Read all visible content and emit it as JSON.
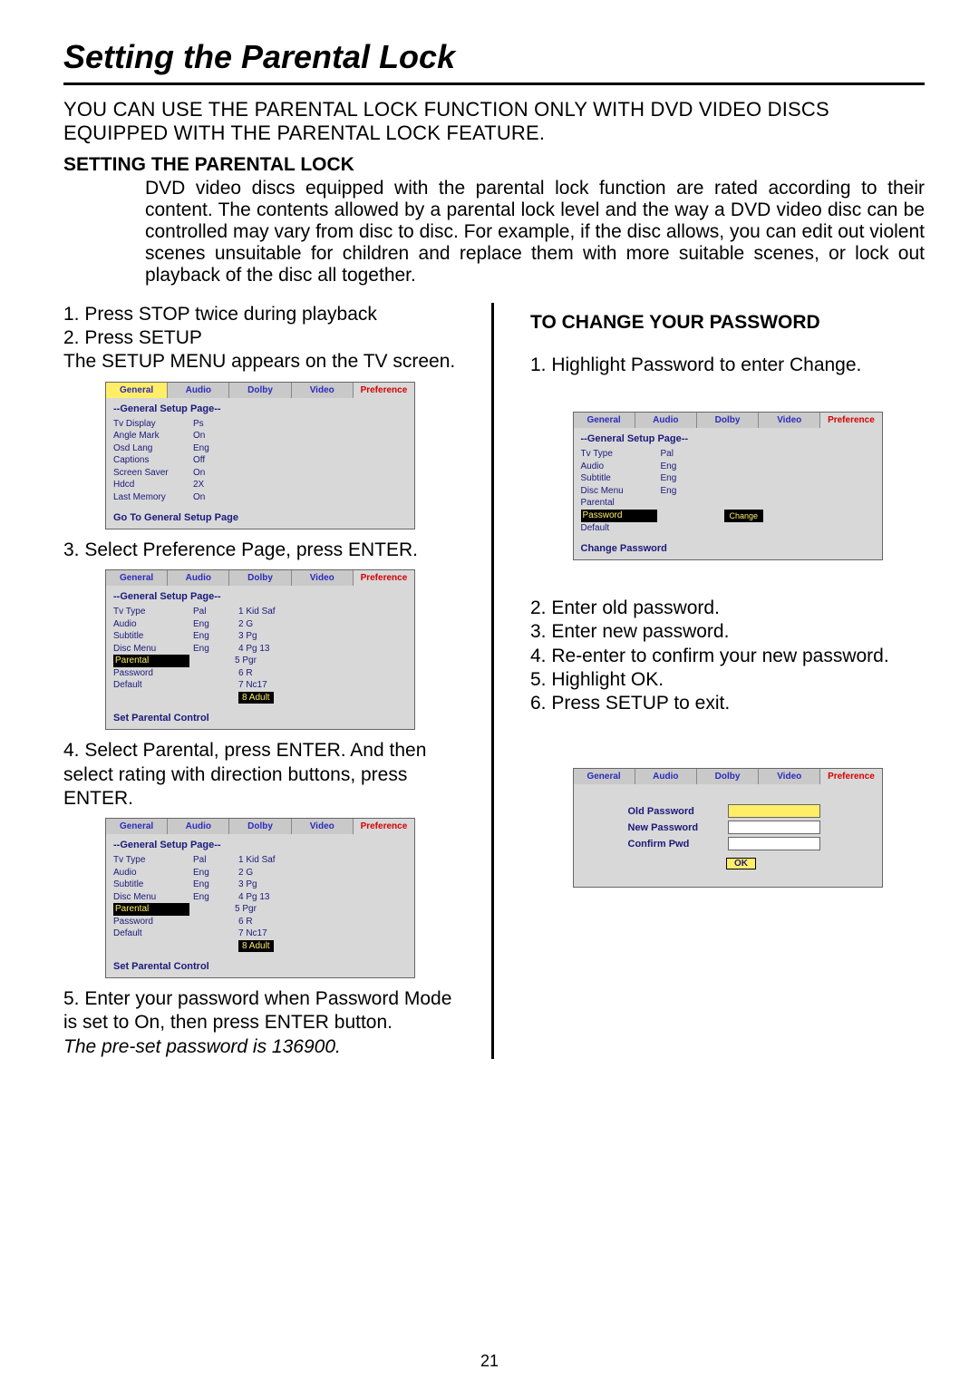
{
  "title": "Setting the Parental Lock",
  "intro": "YOU CAN USE THE PARENTAL LOCK FUNCTION ONLY WITH DVD VIDEO DISCS EQUIPPED WITH THE PARENTAL LOCK FEATURE.",
  "sec1_h": "SETTING THE PARENTAL LOCK",
  "sec1_p": "DVD video discs equipped with the parental lock function are rated according to their content.  The contents allowed by a parental lock level and the way a DVD video disc can be controlled may vary from disc to disc.  For example, if the disc allows, you can edit out violent scenes unsuitable for children and replace them with more suitable scenes, or lock out playback of the disc all together.",
  "left": {
    "s1": "1. Press STOP twice during playback",
    "s2": "2. Press SETUP",
    "s2b": "The SETUP MENU appears on the TV screen.",
    "s3": "3. Select Preference Page,  press ENTER.",
    "s4": "4. Select Parental, press ENTER. And then select rating with direction buttons, press ENTER.",
    "s5": "5. Enter your password when Password Mode is set to On, then press ENTER button.",
    "note": "The pre-set password is 136900."
  },
  "right": {
    "h": "TO CHANGE YOUR PASSWORD",
    "s1": "1. Highlight Password to enter Change.",
    "s2": "2. Enter old password.",
    "s3": "3. Enter new password.",
    "s4": "4. Re-enter to confirm your new password.",
    "s5": "5. Highlight OK.",
    "s6": "6. Press SETUP to exit."
  },
  "tabs": {
    "general": "General",
    "audio": "Audio",
    "dolby": "Dolby",
    "video": "Video",
    "pref": "Preference"
  },
  "pagehd": "--General Setup Page--",
  "f1": {
    "rows": [
      [
        "Tv Display",
        "Ps"
      ],
      [
        "Angle Mark",
        "On"
      ],
      [
        "Osd Lang",
        "Eng"
      ],
      [
        "Captions",
        "Off"
      ],
      [
        "Screen Saver",
        "On"
      ],
      [
        "Hdcd",
        "2X"
      ],
      [
        "Last Memory",
        "On"
      ]
    ],
    "foot": "Go To General Setup Page"
  },
  "ratings": [
    "1 Kid Saf",
    "2 G",
    "3 Pg",
    "4 Pg 13",
    "5 Pgr",
    "6 R",
    "7 Nc17",
    "8 Adult"
  ],
  "f2": {
    "rows": [
      [
        "Tv Type",
        "Pal"
      ],
      [
        "Audio",
        "Eng"
      ],
      [
        "Subtitle",
        "Eng"
      ],
      [
        "Disc Menu",
        "Eng"
      ],
      [
        "Parental",
        ""
      ],
      [
        "Password",
        ""
      ],
      [
        "Default",
        ""
      ]
    ],
    "foot": "Set Parental Control",
    "hl": 4
  },
  "f3": {
    "rows": [
      [
        "Tv Type",
        "Pal"
      ],
      [
        "Audio",
        "Eng"
      ],
      [
        "Subtitle",
        "Eng"
      ],
      [
        "Disc Menu",
        "Eng"
      ],
      [
        "Parental",
        ""
      ],
      [
        "Password",
        ""
      ],
      [
        "Default",
        ""
      ]
    ],
    "foot": "Set Parental Control",
    "hl": 4
  },
  "f4": {
    "rows": [
      [
        "Tv Type",
        "Pal"
      ],
      [
        "Audio",
        "Eng"
      ],
      [
        "Subtitle",
        "Eng"
      ],
      [
        "Disc Menu",
        "Eng"
      ],
      [
        "Parental",
        ""
      ],
      [
        "Password",
        ""
      ],
      [
        "Default",
        ""
      ]
    ],
    "foot": "Change Password",
    "hl": 5,
    "change": "Change"
  },
  "pwd": {
    "old": "Old  Password",
    "new": "New  Password",
    "conf": "Confirm  Pwd",
    "ok": "OK"
  },
  "pageno": "21"
}
